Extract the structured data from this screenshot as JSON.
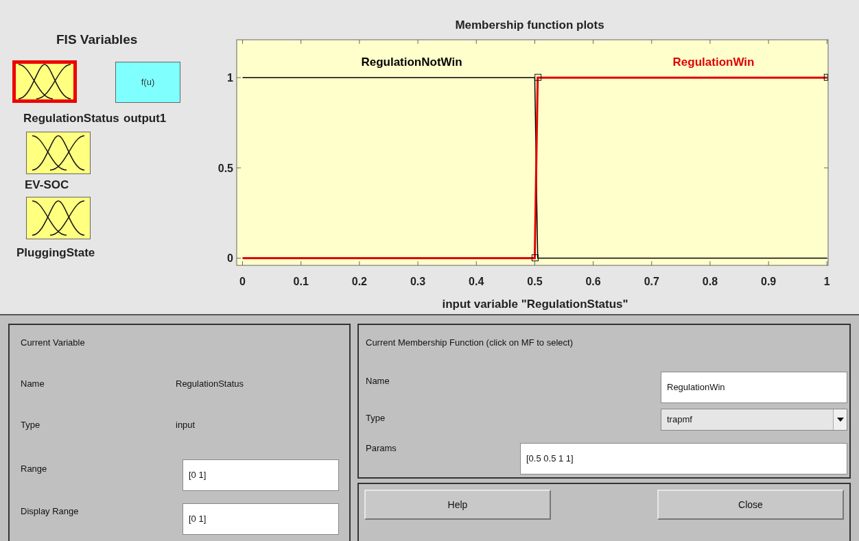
{
  "fis_variables": {
    "title": "FIS Variables",
    "items": [
      {
        "label": "RegulationStatus",
        "kind": "input",
        "selected": true
      },
      {
        "label": "output1",
        "kind": "output",
        "icon_text": "f(u)",
        "selected": false
      },
      {
        "label": "EV-SOC",
        "kind": "input",
        "selected": false
      },
      {
        "label": "PluggingState",
        "kind": "input",
        "selected": false
      }
    ]
  },
  "plot": {
    "chart_data": {
      "type": "line",
      "title": "Membership function plots",
      "xlabel": "input variable \"RegulationStatus\"",
      "x": [
        0,
        0.5,
        0.505,
        1
      ],
      "series": [
        {
          "name": "RegulationNotWin",
          "color": "#000000",
          "values": [
            1,
            1,
            0,
            0
          ]
        },
        {
          "name": "RegulationWin",
          "color": "#e00000",
          "values": [
            0,
            0,
            1,
            1
          ]
        }
      ],
      "xlim": [
        -0.01,
        1.002
      ],
      "ylim": [
        -0.04,
        1.21
      ],
      "xticks": [
        0,
        0.1,
        0.2,
        0.3,
        0.4,
        0.5,
        0.6,
        0.7,
        0.8,
        0.9,
        1
      ],
      "yticks": [
        0,
        0.5,
        1
      ]
    }
  },
  "current_variable": {
    "title": "Current Variable",
    "name_label": "Name",
    "name": "RegulationStatus",
    "type_label": "Type",
    "type": "input",
    "range_label": "Range",
    "range": "[0 1]",
    "display_range_label": "Display Range",
    "display_range": "[0 1]"
  },
  "current_mf": {
    "title": "Current Membership Function (click on MF to select)",
    "name_label": "Name",
    "name": "RegulationWin",
    "type_label": "Type",
    "type": "trapmf",
    "params_label": "Params",
    "params": "[0.5 0.5 1 1]"
  },
  "buttons": [
    "Help",
    "Close"
  ]
}
